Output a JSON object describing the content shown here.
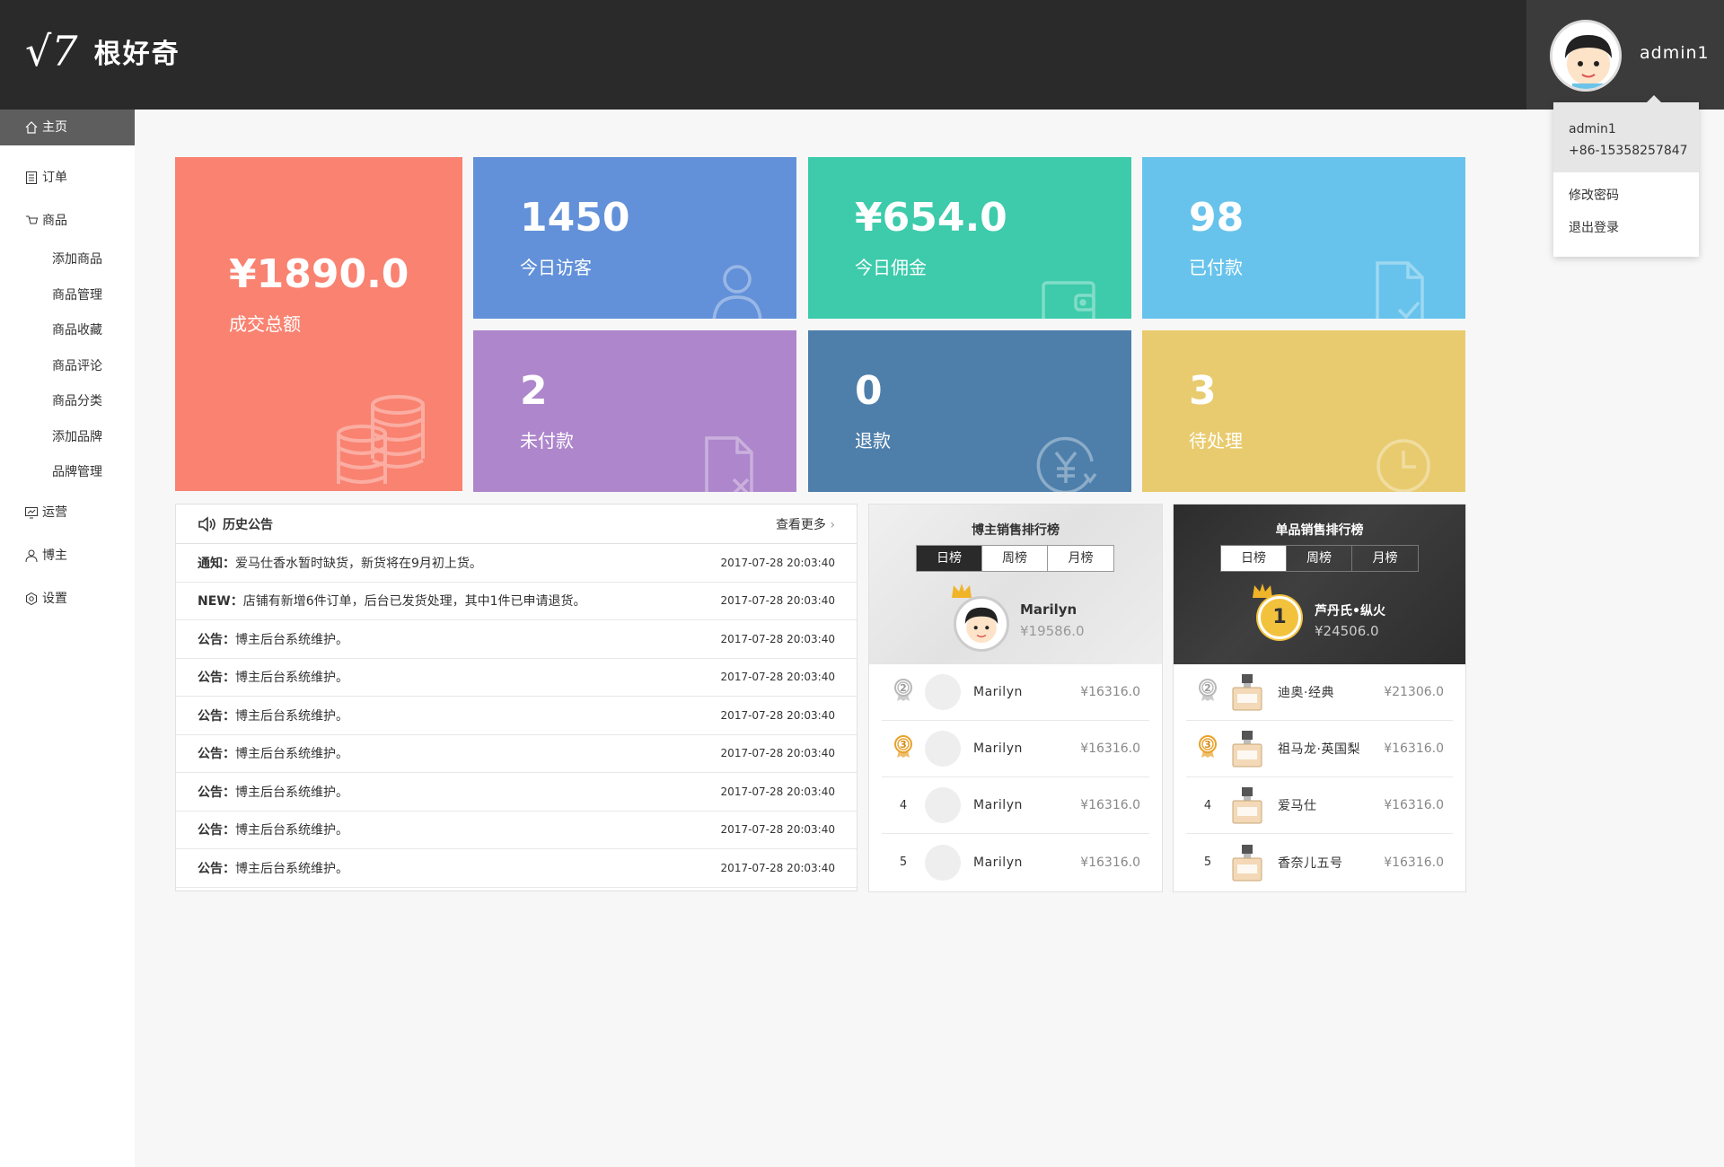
{
  "header": {
    "logo_mark": "√7",
    "logo_text": "根好奇",
    "user_name": "admin1"
  },
  "dropdown": {
    "name": "admin1",
    "phone": "+86-15358257847",
    "change_password": "修改密码",
    "logout": "退出登录"
  },
  "sidebar": {
    "home": "主页",
    "orders": "订单",
    "goods": "商品",
    "goods_sub": [
      "添加商品",
      "商品管理",
      "商品收藏",
      "商品评论",
      "商品分类",
      "添加品牌",
      "品牌管理"
    ],
    "operations": "运营",
    "blogger": "博主",
    "settings": "设置"
  },
  "stats": {
    "total": {
      "value": "¥1890.0",
      "label": "成交总额",
      "color": "#f98271"
    },
    "visitors": {
      "value": "1450",
      "label": "今日访客",
      "color": "#6291d9"
    },
    "commission": {
      "value": "¥654.0",
      "label": "今日佣金",
      "color": "#3dcbab"
    },
    "paid": {
      "value": "98",
      "label": "已付款",
      "color": "#68c3ec"
    },
    "unpaid": {
      "value": "2",
      "label": "未付款",
      "color": "#ae86cc"
    },
    "refund": {
      "value": "0",
      "label": "退款",
      "color": "#4e7fab"
    },
    "pending": {
      "value": "3",
      "label": "待处理",
      "color": "#e9cb6f"
    }
  },
  "notices": {
    "title": "历史公告",
    "more": "查看更多",
    "rows": [
      {
        "tag": "通知：",
        "text": "爱马仕香水暂时缺货，新货将在9月初上货。",
        "time": "2017-07-28  20:03:40"
      },
      {
        "tag": "NEW：",
        "text": "店铺有新增6件订单，后台已发货处理，其中1件已申请退货。",
        "time": "2017-07-28  20:03:40"
      },
      {
        "tag": "公告：",
        "text": "博主后台系统维护。",
        "time": "2017-07-28  20:03:40"
      },
      {
        "tag": "公告：",
        "text": "博主后台系统维护。",
        "time": "2017-07-28  20:03:40"
      },
      {
        "tag": "公告：",
        "text": "博主后台系统维护。",
        "time": "2017-07-28  20:03:40"
      },
      {
        "tag": "公告：",
        "text": "博主后台系统维护。",
        "time": "2017-07-28  20:03:40"
      },
      {
        "tag": "公告：",
        "text": "博主后台系统维护。",
        "time": "2017-07-28  20:03:40"
      },
      {
        "tag": "公告：",
        "text": "博主后台系统维护。",
        "time": "2017-07-28  20:03:40"
      },
      {
        "tag": "公告：",
        "text": "博主后台系统维护。",
        "time": "2017-07-28  20:03:40"
      }
    ]
  },
  "blogger_rank": {
    "title": "博主销售排行榜",
    "tabs": [
      "日榜",
      "周榜",
      "月榜"
    ],
    "top": {
      "name": "Marilyn",
      "amount": "¥19586.0"
    },
    "rows": [
      {
        "rank": "2",
        "name": "Marilyn",
        "amount": "¥16316.0"
      },
      {
        "rank": "3",
        "name": "Marilyn",
        "amount": "¥16316.0"
      },
      {
        "rank": "4",
        "name": "Marilyn",
        "amount": "¥16316.0"
      },
      {
        "rank": "5",
        "name": "Marilyn",
        "amount": "¥16316.0"
      }
    ]
  },
  "product_rank": {
    "title": "单品销售排行榜",
    "tabs": [
      "日榜",
      "周榜",
      "月榜"
    ],
    "top": {
      "rank": "1",
      "name": "芦丹氏•纵火",
      "amount": "¥24506.0"
    },
    "rows": [
      {
        "rank": "2",
        "name": "迪奥·经典",
        "amount": "¥21306.0"
      },
      {
        "rank": "3",
        "name": "祖马龙·英国梨",
        "amount": "¥16316.0"
      },
      {
        "rank": "4",
        "name": "爱马仕",
        "amount": "¥16316.0"
      },
      {
        "rank": "5",
        "name": "香奈儿五号",
        "amount": "¥16316.0"
      }
    ]
  }
}
